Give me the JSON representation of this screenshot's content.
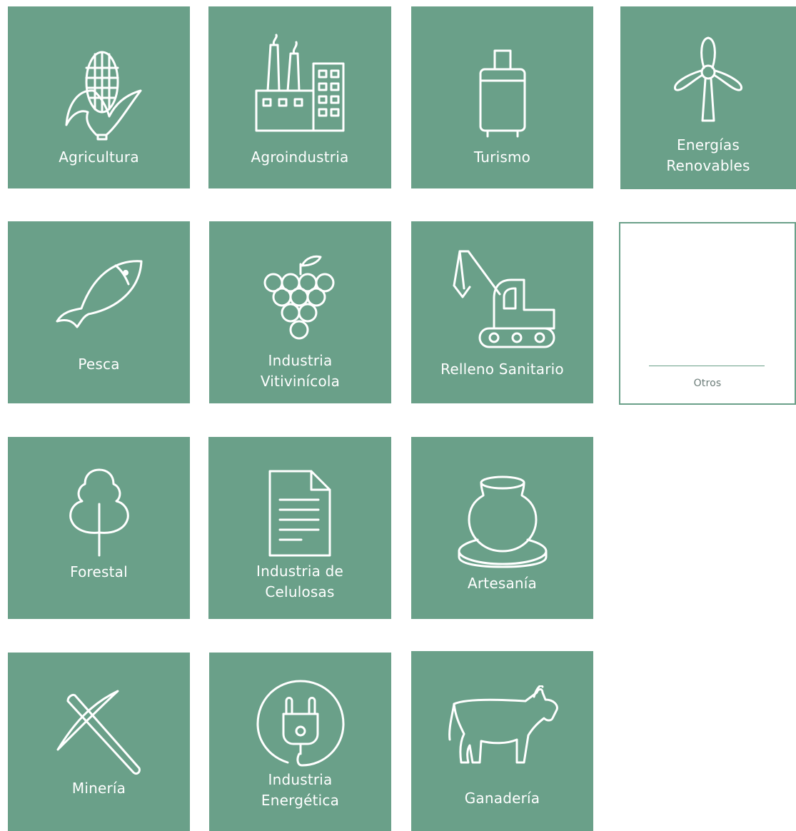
{
  "colors": {
    "tile_bg": "#6aa089",
    "tile_fg": "#ffffff",
    "outline_text": "#6b7c78"
  },
  "tiles": [
    {
      "label": "Agricultura",
      "icon": "corn-icon"
    },
    {
      "label": "Agroindustria",
      "icon": "factory-icon"
    },
    {
      "label": "Turismo",
      "icon": "suitcase-icon"
    },
    {
      "label": "Energías\nRenovables",
      "icon": "wind-turbine-icon"
    },
    {
      "label": "Pesca",
      "icon": "fish-icon"
    },
    {
      "label": "Industria\nVitivinícola",
      "icon": "grapes-icon"
    },
    {
      "label": "Relleno Sanitario",
      "icon": "excavator-icon"
    },
    {
      "label": "Otros",
      "icon": ""
    },
    {
      "label": "Forestal",
      "icon": "tree-icon"
    },
    {
      "label": "Industria de\nCelulosas",
      "icon": "document-icon"
    },
    {
      "label": "Artesanía",
      "icon": "pottery-icon"
    },
    {
      "label": "Minería",
      "icon": "pickaxe-icon"
    },
    {
      "label": "Industria\nEnergética",
      "icon": "plug-icon"
    },
    {
      "label": "Ganadería",
      "icon": "cow-icon"
    }
  ]
}
